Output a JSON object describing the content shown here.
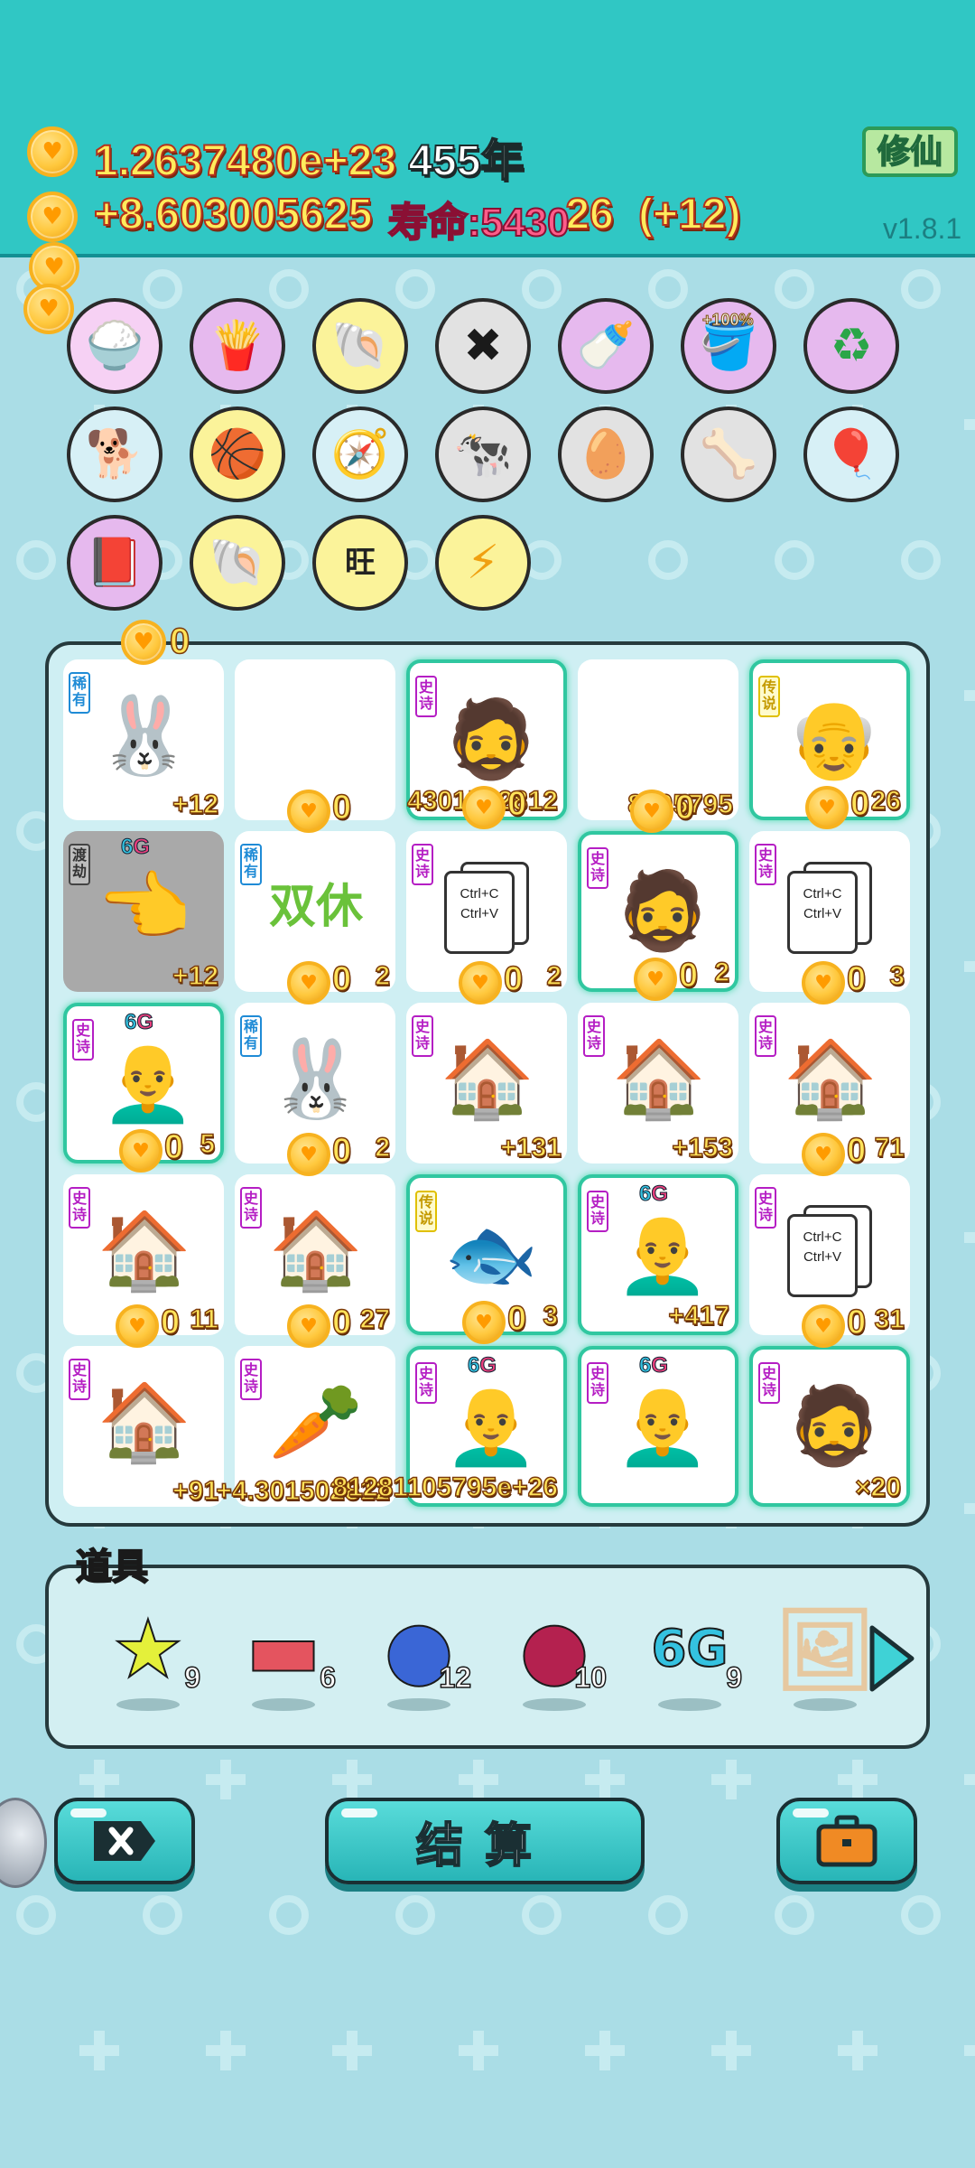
{
  "header": {
    "coins_total": "1.2637480e+23",
    "years": "455年",
    "coins_rate": "+8.603005625",
    "coins_rate_tail": "26",
    "coins_rate_bonus": "(+12)",
    "lifespan_label": "寿命:5430",
    "cultivate_label": "修仙",
    "version": "v1.8.1"
  },
  "relics": {
    "row1": [
      {
        "icon": "rice-bowl-icon",
        "glyph": "🍚",
        "bg": "#f6d1f4"
      },
      {
        "icon": "french-fries-icon",
        "glyph": "🍟",
        "bg": "#e6b9ee"
      },
      {
        "icon": "shell-icon",
        "glyph": "🐚",
        "bg": "#fbf39a"
      },
      {
        "icon": "delete-tag-icon",
        "glyph": "✖",
        "bg": "#e2e2e2"
      },
      {
        "icon": "breast-pump-icon",
        "glyph": "🍼",
        "bg": "#e6b9ee"
      },
      {
        "icon": "bucket-bonus-icon",
        "glyph": "🪣",
        "bg": "#e6b9ee",
        "tag": "+100%"
      },
      {
        "icon": "recycle-icon",
        "glyph": "♻",
        "bg": "#e6b9ee"
      }
    ],
    "row2": [
      {
        "icon": "cool-dog-icon",
        "glyph": "🐕",
        "bg": "#d7f0f6"
      },
      {
        "icon": "basketballs-icon",
        "glyph": "🏀",
        "bg": "#fbf39a"
      },
      {
        "icon": "compass-icon",
        "glyph": "🧭",
        "bg": "#d7f0f6"
      },
      {
        "icon": "twin-cows-icon",
        "glyph": "🐄",
        "bg": "#e2e2e2"
      },
      {
        "icon": "egg-tray-icon",
        "glyph": "🥚",
        "bg": "#e2e2e2"
      },
      {
        "icon": "pet-bowl-icon",
        "glyph": "🦴",
        "bg": "#e2e2e2"
      },
      {
        "icon": "air-pump-icon",
        "glyph": "🎈",
        "bg": "#d7f0f6"
      }
    ],
    "row3": [
      {
        "icon": "time-magazine-icon",
        "glyph": "📕",
        "bg": "#e6b9ee"
      },
      {
        "icon": "shell-icon",
        "glyph": "🐚",
        "bg": "#fbf39a"
      },
      {
        "icon": "wang-characters-icon",
        "glyph": "旺",
        "bg": "#fbf39a"
      },
      {
        "icon": "lightning-icon",
        "glyph": "⚡",
        "bg": "#fbf39a"
      }
    ]
  },
  "board": {
    "top_coin_value": "0",
    "cells": [
      {
        "rarity": "稀有",
        "rclass": "r-blue",
        "art": "rabbit",
        "value": "+12"
      },
      {
        "rarity": "",
        "rclass": "",
        "art": "",
        "value": "",
        "coin": "0"
      },
      {
        "rarity": "史诗",
        "rclass": "r-purple",
        "art": "bearded-man",
        "value": "4301502812",
        "coin": "0",
        "glow": true
      },
      {
        "rarity": "",
        "rclass": "",
        "art": "",
        "value": "8105795",
        "coin": "0"
      },
      {
        "rarity": "传说",
        "rclass": "r-yellow",
        "art": "bald-man-glasses-gold",
        "value": "26",
        "coin": "0",
        "glow": true
      },
      {
        "rarity": "渡劫",
        "rclass": "r-grey",
        "art": "pointing-hand",
        "value": "+12",
        "sixg": true,
        "grey": true
      },
      {
        "rarity": "稀有",
        "rclass": "r-blue",
        "art": "double-rest",
        "value": "2",
        "coin": "0"
      },
      {
        "rarity": "史诗",
        "rclass": "r-purple",
        "art": "ctrl-cv",
        "value": "2",
        "coin": "0"
      },
      {
        "rarity": "史诗",
        "rclass": "r-purple",
        "art": "bearded-man",
        "value": "2",
        "coin": "0",
        "glow": true
      },
      {
        "rarity": "史诗",
        "rclass": "r-purple",
        "art": "ctrl-cv",
        "value": "3",
        "coin": "0"
      },
      {
        "rarity": "史诗",
        "rclass": "r-purple",
        "art": "bald-man",
        "value": "5",
        "coin": "0",
        "sixg": true,
        "glow": true
      },
      {
        "rarity": "稀有",
        "rclass": "r-blue",
        "art": "rabbit",
        "value": "2",
        "coin": "0"
      },
      {
        "rarity": "史诗",
        "rclass": "r-purple",
        "art": "rabbit-house",
        "value": "+131"
      },
      {
        "rarity": "史诗",
        "rclass": "r-purple",
        "art": "rabbit-house",
        "value": "+153"
      },
      {
        "rarity": "史诗",
        "rclass": "r-purple",
        "art": "rabbit-house",
        "value": "71",
        "coin": "0"
      },
      {
        "rarity": "史诗",
        "rclass": "r-purple",
        "art": "rabbit-house",
        "value": "11",
        "coin": "0"
      },
      {
        "rarity": "史诗",
        "rclass": "r-purple",
        "art": "rabbit-house",
        "value": "27",
        "coin": "0"
      },
      {
        "rarity": "传说",
        "rclass": "r-yellow",
        "art": "koi-fish",
        "value": "3",
        "coin": "0",
        "glow": true
      },
      {
        "rarity": "史诗",
        "rclass": "r-purple",
        "art": "bald-man",
        "value": "+417",
        "sixg": true,
        "glow": true
      },
      {
        "rarity": "史诗",
        "rclass": "r-purple",
        "art": "ctrl-cv",
        "value": "31",
        "coin": "0"
      },
      {
        "rarity": "史诗",
        "rclass": "r-purple",
        "art": "rabbit-house",
        "value": "+91"
      },
      {
        "rarity": "史诗",
        "rclass": "r-purple",
        "art": "carrot",
        "value": "+4.301502812"
      },
      {
        "rarity": "史诗",
        "rclass": "r-purple",
        "art": "bald-man",
        "value": "81281105795e+26",
        "sixg": true,
        "glow": true
      },
      {
        "rarity": "史诗",
        "rclass": "r-purple",
        "art": "bald-man",
        "value": "",
        "sixg": true,
        "glow": true
      },
      {
        "rarity": "史诗",
        "rclass": "r-purple",
        "art": "bearded-man",
        "value": "×20",
        "glow": true
      }
    ]
  },
  "items": {
    "title": "道具",
    "list": [
      {
        "icon": "star-icon",
        "glyph": "★",
        "color": "#e4f03a",
        "count": "9"
      },
      {
        "icon": "liver-icon",
        "glyph": "▬",
        "color": "#e4545f",
        "count": "6"
      },
      {
        "icon": "blueberry-icon",
        "glyph": "●",
        "color": "#3a66d6",
        "count": "12"
      },
      {
        "icon": "lychee-icon",
        "glyph": "●",
        "color": "#b4214f",
        "count": "10"
      },
      {
        "icon": "six-g-icon",
        "glyph": "6G",
        "color": "#34c2e0",
        "count": "9"
      },
      {
        "icon": "portrait-frame-icon",
        "glyph": "🖼",
        "color": "#e6c8a0",
        "count": ""
      }
    ]
  },
  "buttons": {
    "settle_label": "结算"
  },
  "sixg_text": "6",
  "sixg_g": "G"
}
